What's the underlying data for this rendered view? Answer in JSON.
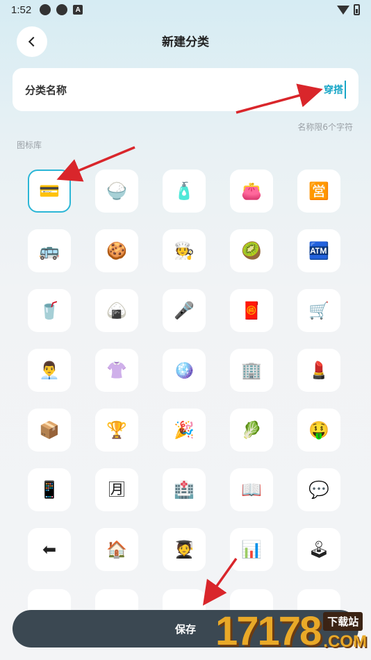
{
  "status_bar": {
    "time": "1:52",
    "a_badge": "A"
  },
  "header": {
    "title": "新建分类",
    "back_icon": "chevron-left-icon"
  },
  "name_field": {
    "label": "分类名称",
    "value": "穿搭"
  },
  "limit_hint": "名称限6个字符",
  "library_title": "图标库",
  "icons": [
    {
      "name": "credit-card",
      "glyph": "💳"
    },
    {
      "name": "rice-bowl",
      "glyph": "🍚"
    },
    {
      "name": "lotion-bottle",
      "glyph": "🧴"
    },
    {
      "name": "purse",
      "glyph": "👛"
    },
    {
      "name": "business-badge",
      "glyph": "🈺"
    },
    {
      "name": "bus",
      "glyph": "🚌"
    },
    {
      "name": "cookie",
      "glyph": "🍪"
    },
    {
      "name": "cook",
      "glyph": "🧑‍🍳"
    },
    {
      "name": "kiwi",
      "glyph": "🥝"
    },
    {
      "name": "atm",
      "glyph": "🏧"
    },
    {
      "name": "drink-cup",
      "glyph": "🥤"
    },
    {
      "name": "rice-ball",
      "glyph": "🍙"
    },
    {
      "name": "microphone",
      "glyph": "🎤"
    },
    {
      "name": "red-envelope",
      "glyph": "🧧"
    },
    {
      "name": "shopping-cart",
      "glyph": "🛒"
    },
    {
      "name": "office-worker",
      "glyph": "👨‍💼"
    },
    {
      "name": "blouse",
      "glyph": "👚"
    },
    {
      "name": "disco-ball",
      "glyph": "🪩"
    },
    {
      "name": "office-building",
      "glyph": "🏢"
    },
    {
      "name": "lipstick",
      "glyph": "💄"
    },
    {
      "name": "package",
      "glyph": "📦"
    },
    {
      "name": "trophy",
      "glyph": "🏆"
    },
    {
      "name": "party-popper",
      "glyph": "🎉"
    },
    {
      "name": "leafy-green",
      "glyph": "🥬"
    },
    {
      "name": "money-mouth-face",
      "glyph": "🤑"
    },
    {
      "name": "mobile-phone",
      "glyph": "📱"
    },
    {
      "name": "monthly-badge",
      "glyph": "🈷"
    },
    {
      "name": "hospital",
      "glyph": "🏥"
    },
    {
      "name": "open-book",
      "glyph": "📖"
    },
    {
      "name": "speech-bubble",
      "glyph": "💬"
    },
    {
      "name": "back-arrow",
      "glyph": "⬅"
    },
    {
      "name": "house",
      "glyph": "🏠"
    },
    {
      "name": "graduate",
      "glyph": "🧑‍🎓"
    },
    {
      "name": "bar-chart",
      "glyph": "📊"
    },
    {
      "name": "joystick",
      "glyph": "🕹"
    }
  ],
  "selected_index": 0,
  "save_label": "保存",
  "colors": {
    "accent": "#17a6c7",
    "save_bg": "#3b4852",
    "arrow": "#d9262b"
  },
  "watermark": {
    "digits": "17178",
    "site": "下载站",
    "com": ".COM"
  }
}
